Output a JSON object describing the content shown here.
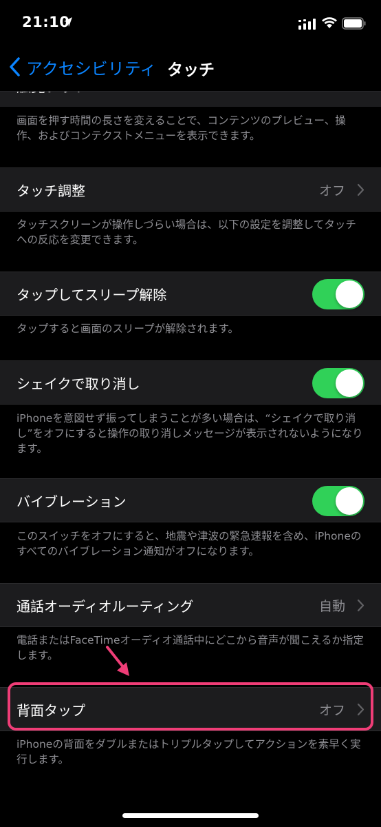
{
  "status_bar": {
    "time": "21:10"
  },
  "nav": {
    "back_label": "アクセシビリティ",
    "title": "タッチ"
  },
  "sections": {
    "haptic_touch": {
      "partial_label": "触覚タッチ",
      "footer": "画面を押す時間の長さを変えることで、コンテンツのプレビュー、操作、およびコンテクストメニューを表示できます。"
    },
    "touch_accommodations": {
      "label": "タッチ調整",
      "value": "オフ",
      "footer": "タッチスクリーンが操作しづらい場合は、以下の設定を調整してタッチへの反応を変更できます。"
    },
    "tap_to_wake": {
      "label": "タップしてスリープ解除",
      "on": true,
      "footer": "タップすると画面のスリープが解除されます。"
    },
    "shake_to_undo": {
      "label": "シェイクで取り消し",
      "on": true,
      "footer": "iPhoneを意図せず振ってしまうことが多い場合は、“シェイクで取り消し”をオフにすると操作の取り消しメッセージが表示されないようになります。"
    },
    "vibration": {
      "label": "バイブレーション",
      "on": true,
      "footer": "このスイッチをオフにすると、地震や津波の緊急速報を含め、iPhoneのすべてのバイブレーション通知がオフになります。"
    },
    "call_audio_routing": {
      "label": "通話オーディオルーティング",
      "value": "自動",
      "footer": "電話またはFaceTimeオーディオ通話中にどこから音声が聞こえるか指定します。"
    },
    "back_tap": {
      "label": "背面タップ",
      "value": "オフ",
      "footer": "iPhoneの背面をダブルまたはトリプルタップしてアクションを素早く実行します。"
    }
  },
  "colors": {
    "accent": "#0a84ff",
    "toggle_on": "#30d158",
    "highlight": "#ef3d77",
    "cell_background": "#1c1c1e",
    "secondary_text": "#8e8e93"
  }
}
